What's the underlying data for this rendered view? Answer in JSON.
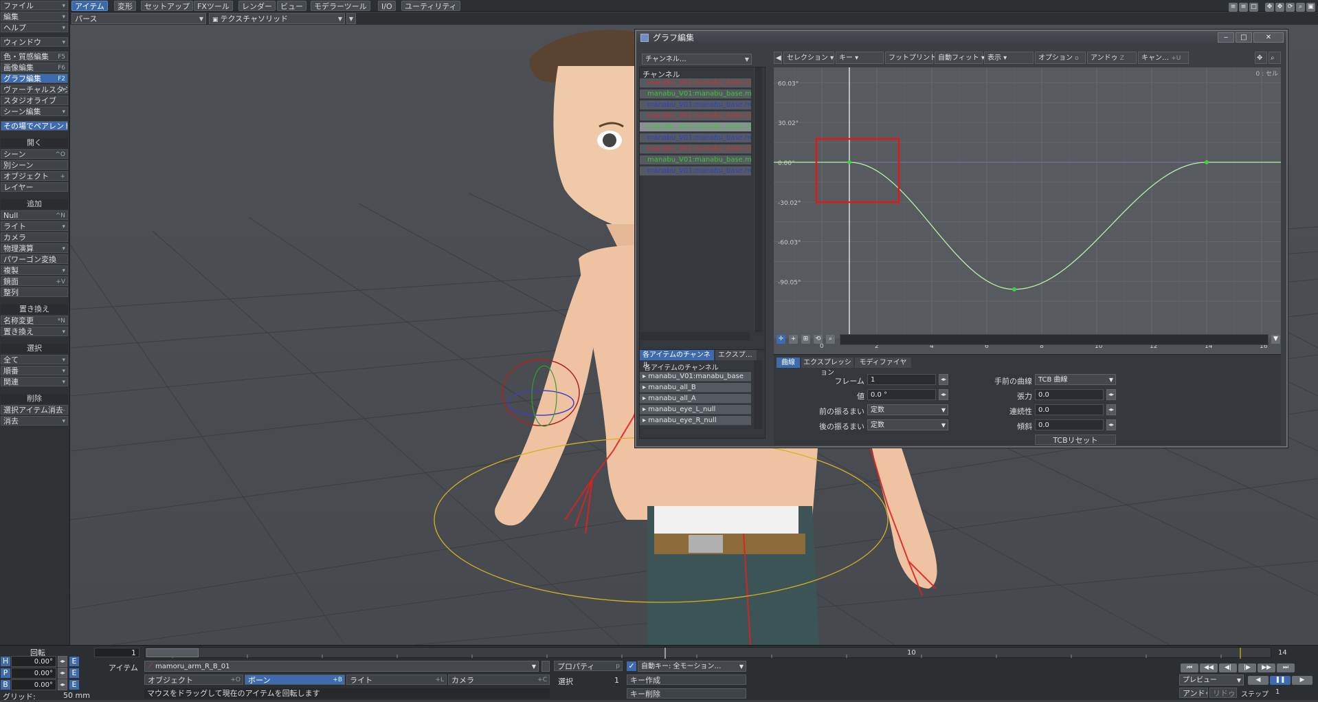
{
  "top_tabs": [
    "アイテム",
    "変形",
    "セットアップ",
    "FXツール",
    "レンダー",
    "ビュー",
    "モデラーツール",
    "I/O",
    "ユーティリティ"
  ],
  "viewport": {
    "view_mode": "パース",
    "render_mode": "テクスチャソリッド"
  },
  "left_panel": {
    "file": "ファイル",
    "edit": "編集",
    "help": "ヘルプ",
    "window": "ウィンドウ",
    "surface_edit": "色・質感編集",
    "surface_edit_key": "F5",
    "image_edit": "画像編集",
    "image_edit_key": "F6",
    "graph_edit": "グラフ編集",
    "graph_edit_key": "F2",
    "virtual_studio": "ヴァーチャルスタジオ",
    "studio_live": "スタジオライブ",
    "scene_edit": "シーン編集",
    "parent_in_place": "その場でペアレント",
    "open_header": "開く",
    "scene": "シーン",
    "scene_key": "^O",
    "other_scene": "別シーン",
    "object": "オブジェクト",
    "object_key": "+",
    "layer": "レイヤー",
    "add_header": "追加",
    "null": "Null",
    "null_key": "^N",
    "light": "ライト",
    "camera": "カメラ",
    "physics": "物理演算",
    "polygon_convert": "パワーゴン変換",
    "clone": "複製",
    "mirror": "鏡面",
    "mirror_key": "+V",
    "array": "整列",
    "replace_header": "置き換え",
    "rename": "名称変更",
    "rename_key": "*N",
    "replace": "置き換え",
    "select_header": "選択",
    "all": "全て",
    "order": "順番",
    "related": "関連",
    "delete_header": "削除",
    "delete_selected": "選択アイテム消去",
    "delete_selected_key": "-",
    "clear": "消去"
  },
  "graph_editor": {
    "title": "グラフ編集",
    "channel_dropdown": "チャンネル…",
    "channel_header": "チャンネル",
    "channels": [
      {
        "name": "manabu_V01:manabu_base.ma",
        "color": "#d03030"
      },
      {
        "name": "manabu_V01:manabu_base.ma",
        "color": "#38c838"
      },
      {
        "name": "manabu_V01:manabu_base.ma",
        "color": "#2c40d0"
      },
      {
        "name": "manabu_V01:manabu_base.ma",
        "color": "#d03030"
      },
      {
        "name": "manabu_V01:manabu_base.ma",
        "color": "#38c838"
      },
      {
        "name": "manabu_V01:manabu_base.ma",
        "color": "#2c40d0"
      },
      {
        "name": "manabu_V01:manabu_base.ma",
        "color": "#d03030"
      },
      {
        "name": "manabu_V01:manabu_base.ma",
        "color": "#38c838"
      },
      {
        "name": "manabu_V01:manabu_base.ma",
        "color": "#2c40d0"
      }
    ],
    "item_tabs": [
      "各アイテムのチャンネル",
      "エクスプ…"
    ],
    "item_list_header": "各アイテムのチャンネル",
    "items": [
      "manabu_V01:manabu_base",
      "manabu_all_B",
      "manabu_all_A",
      "manabu_eye_L_null",
      "manabu_eye_R_null"
    ],
    "toolbar": [
      "セレクション",
      "キー",
      "フットプリント",
      "自動フィット",
      "表示",
      "オプション",
      "アンドゥ",
      "キャン…"
    ],
    "toolbar_keys": {
      "undo": "Z",
      "cancel": "+U",
      "option": "o"
    },
    "frame_readout": "0 : セル",
    "y_ticks": [
      "60.03°",
      "30.02°",
      "0.00°",
      "-30.02°",
      "-60.03°",
      "-90.05°"
    ],
    "x_ticks": [
      "0",
      "2",
      "4",
      "6",
      "8",
      "10",
      "12",
      "14",
      "16"
    ],
    "curve_keys": [
      {
        "frame": 1,
        "value": 0.0
      },
      {
        "frame": 7,
        "value": -96.0
      },
      {
        "frame": 14,
        "value": 0.0
      }
    ],
    "current_frame": 1,
    "lower_tabs": [
      "曲線",
      "エクスプレッション",
      "モディファイヤ"
    ],
    "labels": {
      "frame": "フレーム",
      "value": "値",
      "pre": "前の振るまい",
      "post": "後の振るまい",
      "incoming": "手前の曲線",
      "tension": "張力",
      "continuity": "連続性",
      "bias": "傾斜"
    },
    "values": {
      "frame": "1",
      "value": "0.0 °",
      "pre": "定数",
      "post": "定数",
      "incoming": "TCB 曲線",
      "tension": "0.0",
      "continuity": "0.0",
      "bias": "0.0"
    },
    "tcb_reset": "TCBリセット"
  },
  "bottom": {
    "rotate": "回転",
    "H": "H",
    "P": "P",
    "B": "B",
    "E": "E",
    "h_val": "0.00°",
    "p_val": "0.00°",
    "b_val": "0.00°",
    "grid_label": "グリッド:",
    "grid_val": "50 mm",
    "frame_start": "1",
    "timeline_mid": "10",
    "timeline_end": "14",
    "item_label": "アイテム",
    "current_item": "mamoru_arm_R_B_01",
    "properties": "プロパティ",
    "properties_key": "p",
    "object_btn": "オブジェクト",
    "object_key": "+O",
    "bone_btn": "ボーン",
    "bone_key": "+B",
    "light_btn": "ライト",
    "light_key": "+L",
    "camera_btn": "カメラ",
    "camera_key": "+C",
    "select_label": "選択",
    "select_count": "1",
    "autokey": "自動キー: 全モーション…",
    "create_key": "キー作成",
    "delete_key": "キー削除",
    "status": "マウスをドラッグして現在のアイテムを回転します",
    "preview": "プレビュー",
    "undo": "アンドゥ",
    "redo": "リドゥ",
    "step": "ステップ",
    "step_val": "1"
  }
}
